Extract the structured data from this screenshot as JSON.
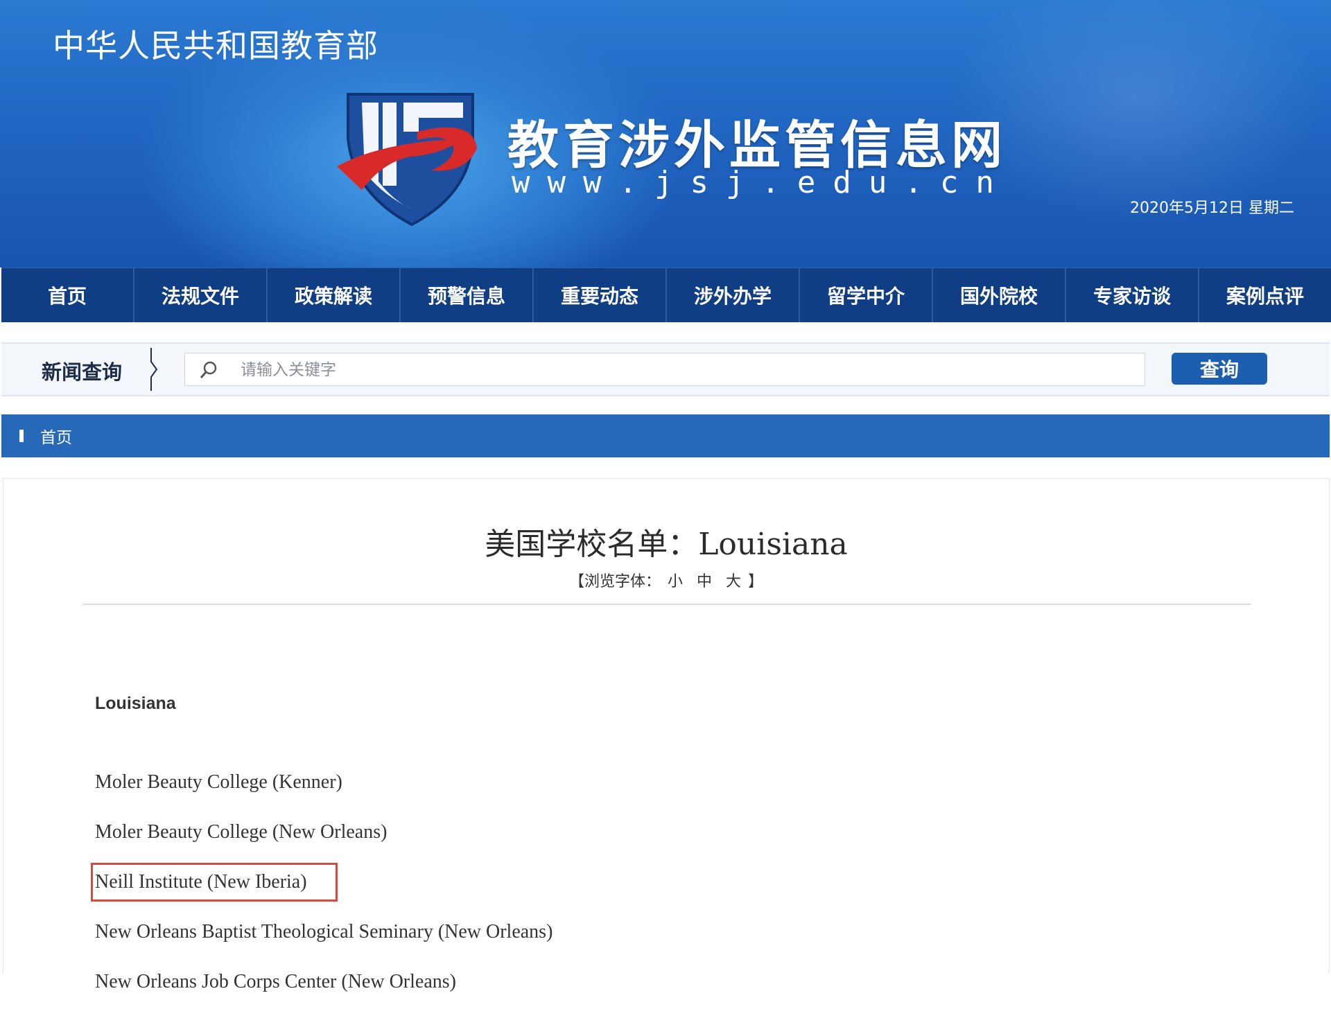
{
  "header": {
    "ministry": "中华人民共和国教育部",
    "site_title": "教育涉外监管信息网",
    "site_url": "www.jsj.edu.cn",
    "date": "2020年5月12日 星期二"
  },
  "nav": {
    "items": [
      "首页",
      "法规文件",
      "政策解读",
      "预警信息",
      "重要动态",
      "涉外办学",
      "留学中介",
      "国外院校",
      "专家访谈",
      "案例点评"
    ]
  },
  "search": {
    "label": "新闻查询",
    "placeholder": "请输入关键字",
    "button": "查询"
  },
  "breadcrumb": {
    "home": "首页"
  },
  "article": {
    "title": "美国学校名单：Louisiana",
    "font_size": {
      "prefix": "【浏览字体：",
      "small": "小",
      "medium": "中",
      "large": "大",
      "suffix": "】"
    },
    "state_heading": "Louisiana",
    "schools": [
      "Moler Beauty College (Kenner)",
      "Moler Beauty College (New Orleans)",
      "Neill Institute (New Iberia)",
      "New Orleans Baptist Theological Seminary (New Orleans)",
      "New Orleans Job Corps Center (New Orleans)"
    ]
  },
  "colors": {
    "nav_bg": "#103e84",
    "breadcrumb_bg": "#2769b9",
    "button_bg": "#1c5fb0",
    "highlight_border": "#d9473d"
  }
}
